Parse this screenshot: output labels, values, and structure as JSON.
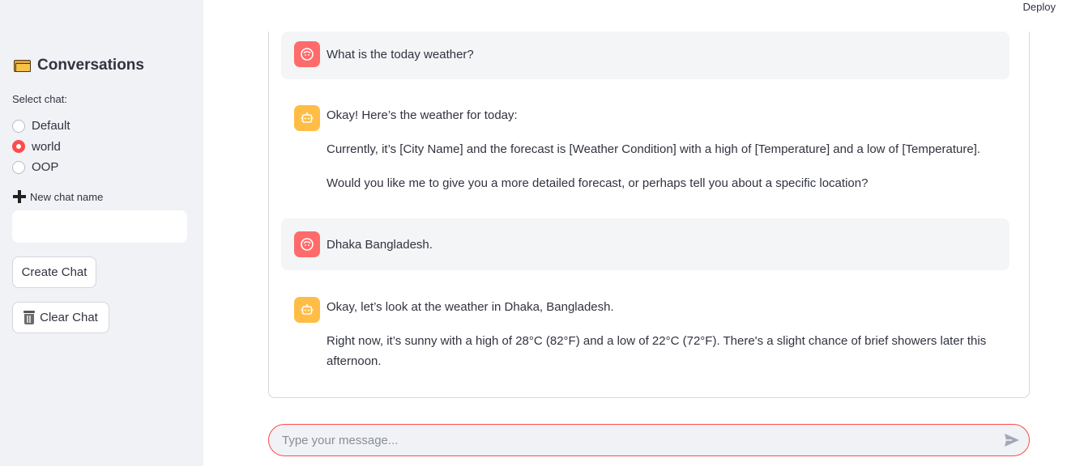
{
  "header": {
    "deploy_label": "Deploy"
  },
  "sidebar": {
    "title": "Conversations",
    "select_label": "Select chat:",
    "chats": [
      {
        "label": "Default",
        "selected": false
      },
      {
        "label": "world",
        "selected": true
      },
      {
        "label": "OOP",
        "selected": false
      }
    ],
    "new_chat_label": "New chat name",
    "new_chat_value": "",
    "create_button": "Create Chat",
    "clear_button": "Clear Chat"
  },
  "messages": [
    {
      "role": "user",
      "paragraphs": [
        "What is the today weather?"
      ]
    },
    {
      "role": "assistant",
      "paragraphs": [
        "Okay! Here’s the weather for today:",
        "Currently, it’s [City Name] and the forecast is [Weather Condition] with a high of [Temperature] and a low of [Temperature].",
        "Would you like me to give you a more detailed forecast, or perhaps tell you about a specific location?"
      ]
    },
    {
      "role": "user",
      "paragraphs": [
        "Dhaka Bangladesh."
      ]
    },
    {
      "role": "assistant",
      "paragraphs": [
        "Okay, let’s look at the weather in Dhaka, Bangladesh.",
        "Right now, it’s sunny with a high of 28°C (82°F) and a low of 22°C (72°F). There's a slight chance of brief showers later this afternoon."
      ]
    }
  ],
  "chat_input": {
    "placeholder": "Type your message...",
    "value": ""
  },
  "colors": {
    "accent": "#ff4b4b",
    "user_avatar": "#ff6b6b",
    "bot_avatar": "#ffbd45",
    "sidebar_bg": "#f0f2f6"
  }
}
